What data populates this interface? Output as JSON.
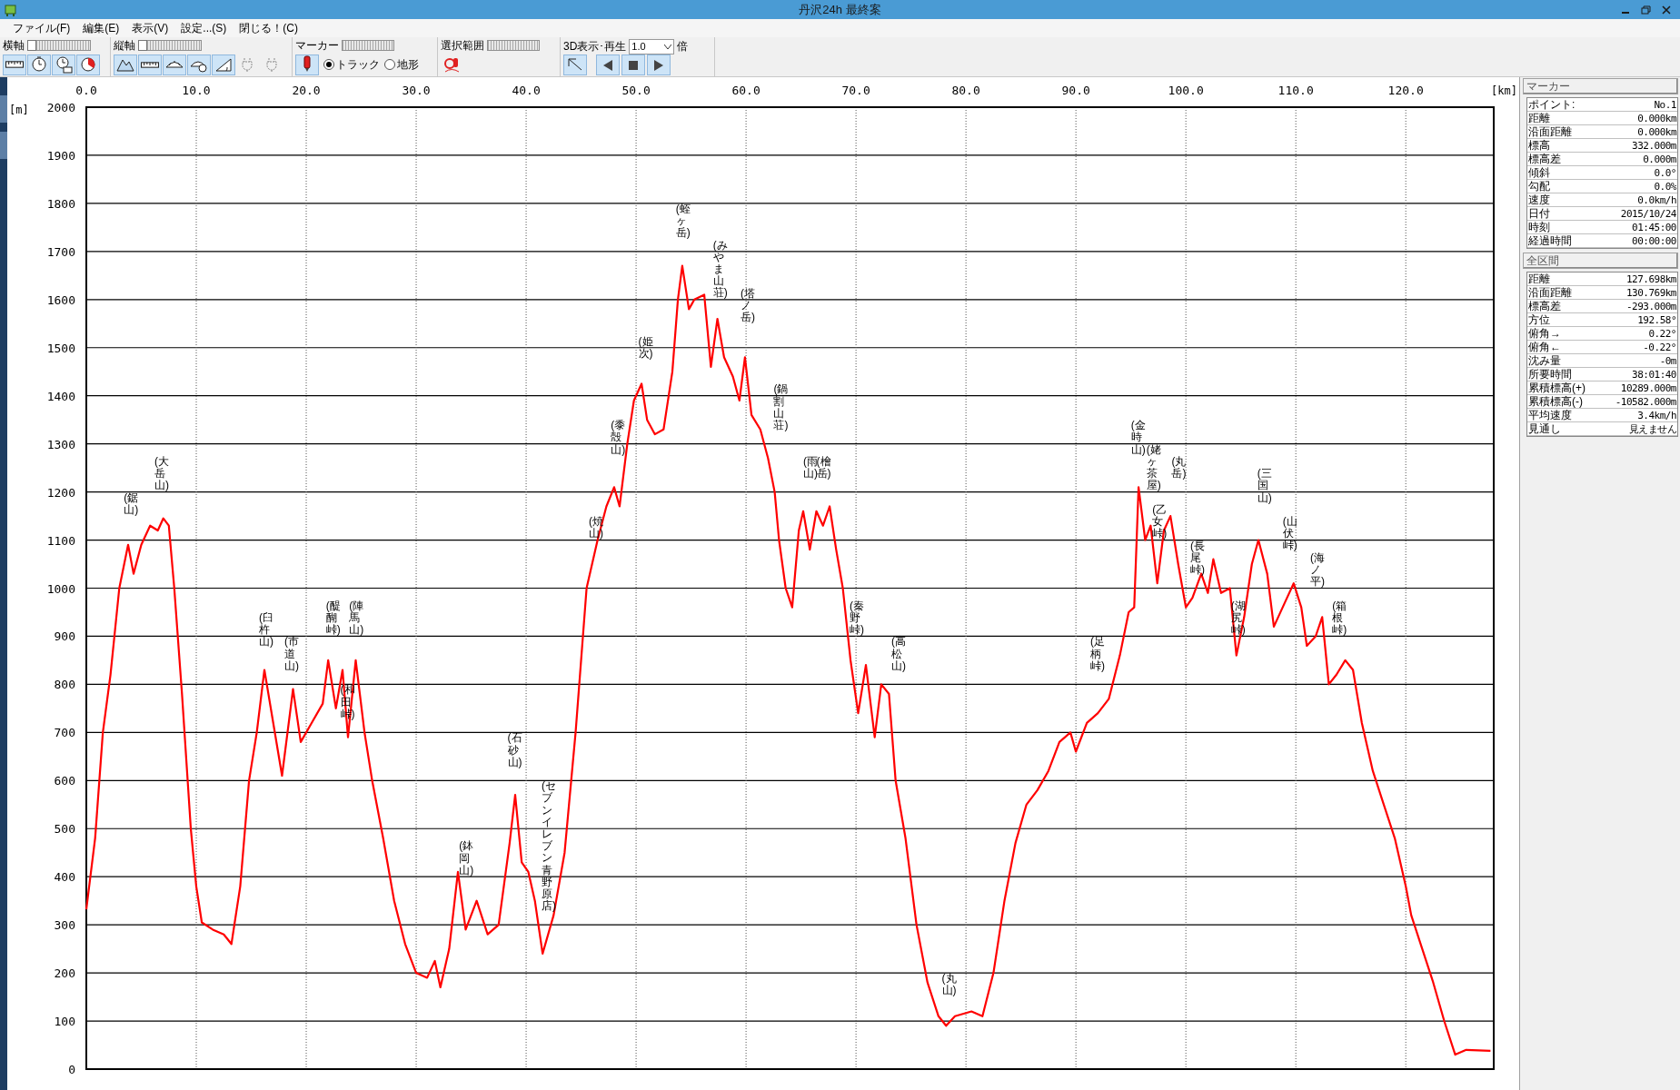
{
  "window": {
    "title": "丹沢24h 最終案"
  },
  "menu": [
    "ファイル(F)",
    "編集(E)",
    "表示(V)",
    "設定...(S)",
    "閉じる！(C)"
  ],
  "toolbar": {
    "horizontal_axis": {
      "label": "横軸",
      "level": 0
    },
    "vertical_axis": {
      "label": "縦軸",
      "level": 0
    },
    "marker": {
      "label": "マーカー",
      "options": [
        {
          "label": "トラック",
          "selected": true
        },
        {
          "label": "地形",
          "selected": false
        }
      ]
    },
    "selection": {
      "label": "選択範囲"
    },
    "playback": {
      "label": "3D表示･再生",
      "speed": "1.0",
      "unit": "倍"
    }
  },
  "chart": {
    "chart_data": {
      "type": "line",
      "grid": true,
      "xlabel": "[km]",
      "ylabel": "[m]",
      "xlim": [
        0,
        128
      ],
      "ylim": [
        0,
        2000
      ],
      "xticks": [
        {
          "value": 0,
          "label": "0.0"
        },
        {
          "value": 10,
          "label": "10.0"
        },
        {
          "value": 20,
          "label": "20.0"
        },
        {
          "value": 30,
          "label": "30.0"
        },
        {
          "value": 40,
          "label": "40.0"
        },
        {
          "value": 50,
          "label": "50.0"
        },
        {
          "value": 60,
          "label": "60.0"
        },
        {
          "value": 70,
          "label": "70.0"
        },
        {
          "value": 80,
          "label": "80.0"
        },
        {
          "value": 90,
          "label": "90.0"
        },
        {
          "value": 100,
          "label": "100.0"
        },
        {
          "value": 110,
          "label": "110.0"
        },
        {
          "value": 120,
          "label": "120.0"
        }
      ],
      "yticks": [
        0,
        100,
        200,
        300,
        400,
        500,
        600,
        700,
        800,
        900,
        1000,
        1100,
        1200,
        1300,
        1400,
        1500,
        1600,
        1700,
        1800,
        1900,
        2000
      ],
      "x": [
        0,
        0.8,
        1.5,
        2.2,
        3.0,
        3.8,
        4.3,
        5.0,
        5.8,
        6.5,
        7.0,
        7.5,
        8.0,
        8.7,
        9.5,
        10.0,
        10.5,
        11.5,
        12.5,
        13.2,
        14.0,
        14.8,
        15.5,
        16.2,
        17.0,
        17.8,
        18.8,
        19.5,
        20.5,
        21.5,
        22.0,
        22.7,
        23.3,
        23.8,
        24.5,
        25.3,
        26.0,
        27.0,
        28.0,
        29.0,
        30.0,
        31.0,
        31.7,
        32.2,
        33.0,
        33.8,
        34.5,
        35.5,
        36.5,
        37.5,
        38.5,
        39.0,
        39.6,
        40.2,
        40.8,
        41.5,
        42.5,
        43.5,
        44.5,
        45.5,
        46.5,
        47.3,
        48.0,
        48.5,
        49.2,
        49.8,
        50.5,
        51.0,
        51.7,
        52.5,
        53.3,
        53.8,
        54.2,
        54.8,
        55.3,
        56.2,
        56.8,
        57.4,
        58.0,
        58.8,
        59.4,
        59.9,
        60.5,
        61.3,
        62.0,
        62.6,
        63.0,
        63.6,
        64.2,
        64.8,
        65.2,
        65.8,
        66.4,
        67.0,
        67.6,
        68.2,
        68.8,
        69.5,
        70.2,
        70.9,
        71.7,
        72.3,
        73.0,
        73.6,
        74.5,
        75.5,
        76.5,
        77.5,
        78.2,
        79.0,
        80.5,
        81.5,
        82.5,
        83.5,
        84.5,
        85.5,
        86.5,
        87.5,
        88.5,
        89.5,
        90.0,
        91.0,
        92.0,
        93.0,
        94.0,
        94.8,
        95.3,
        95.7,
        96.3,
        96.8,
        97.4,
        98.0,
        98.6,
        99.3,
        100.0,
        100.6,
        101.4,
        102.0,
        102.5,
        103.2,
        104.0,
        104.6,
        105.3,
        106.0,
        106.6,
        107.4,
        108.0,
        109.0,
        109.8,
        110.5,
        111.0,
        111.8,
        112.4,
        113.0,
        113.7,
        114.5,
        115.2,
        116.0,
        117.0,
        118.0,
        119.0,
        120.0,
        120.5,
        121.5,
        122.5,
        123.5,
        124.5,
        125.5,
        127.7
      ],
      "series": [
        {
          "color": "#ff0000",
          "values": [
            332,
            480,
            700,
            820,
            1000,
            1090,
            1030,
            1090,
            1130,
            1120,
            1145,
            1130,
            1000,
            780,
            500,
            380,
            305,
            290,
            280,
            260,
            380,
            600,
            700,
            830,
            720,
            610,
            790,
            680,
            720,
            760,
            850,
            750,
            830,
            690,
            850,
            700,
            600,
            480,
            350,
            260,
            200,
            190,
            225,
            170,
            250,
            410,
            290,
            350,
            280,
            300,
            470,
            570,
            430,
            410,
            350,
            240,
            320,
            450,
            700,
            1000,
            1100,
            1170,
            1210,
            1170,
            1300,
            1390,
            1425,
            1350,
            1320,
            1330,
            1450,
            1600,
            1670,
            1580,
            1600,
            1610,
            1460,
            1560,
            1480,
            1440,
            1390,
            1480,
            1360,
            1330,
            1270,
            1200,
            1100,
            1000,
            960,
            1120,
            1160,
            1080,
            1160,
            1130,
            1170,
            1080,
            1000,
            850,
            740,
            840,
            690,
            800,
            780,
            600,
            480,
            300,
            180,
            110,
            90,
            110,
            120,
            110,
            200,
            350,
            470,
            550,
            580,
            620,
            680,
            700,
            660,
            720,
            740,
            770,
            860,
            950,
            960,
            1210,
            1100,
            1130,
            1010,
            1120,
            1150,
            1050,
            960,
            980,
            1030,
            990,
            1060,
            990,
            1000,
            860,
            940,
            1050,
            1100,
            1030,
            920,
            970,
            1010,
            960,
            880,
            900,
            940,
            800,
            820,
            850,
            830,
            720,
            620,
            550,
            480,
            380,
            320,
            250,
            180,
            100,
            30,
            40,
            38
          ]
        }
      ],
      "annotations": [
        "(鋸山)",
        "(大岳山)",
        "(臼杵山)",
        "(市道山)",
        "(醍醐峠)",
        "(和田峠)",
        "(陣馬山)",
        "(鉢岡山)",
        "(石砂山)",
        "(セブンイレブン青野原店)",
        "(焼山)",
        "(黍殻山)",
        "(姫次)",
        "(蛭ヶ岳)",
        "(みやま山荘)",
        "(塔ノ岳)",
        "(鍋割山荘)",
        "(雨山)",
        "(檜岳)",
        "(秦野峠)",
        "(高松山)",
        "(丸山)",
        "(足柄峠)",
        "(金時山)",
        "(姥ヶ茶屋)",
        "(乙女峠)",
        "(丸岳)",
        "(長尾峠)",
        "(湖尻峠)",
        "(三国山)",
        "(山伏峠)",
        "(海ノ平)",
        "(箱根峠)"
      ]
    }
  },
  "marker_panel": {
    "title": "マーカー",
    "rows": [
      {
        "label": "ポイント:",
        "value": "No.1"
      },
      {
        "label": "距離",
        "value": "0.000km"
      },
      {
        "label": "沿面距離",
        "value": "0.000km"
      },
      {
        "label": "標高",
        "value": "332.000m"
      },
      {
        "label": "標高差",
        "value": "0.000m"
      },
      {
        "label": "傾斜",
        "value": "0.0°"
      },
      {
        "label": "勾配",
        "value": "0.0%"
      },
      {
        "label": "速度",
        "value": "0.0km/h"
      },
      {
        "label": "日付",
        "value": "2015/10/24"
      },
      {
        "label": "時刻",
        "value": "01:45:00"
      },
      {
        "label": "経過時間",
        "value": "00:00:00"
      }
    ]
  },
  "total_panel": {
    "title": "全区間",
    "rows": [
      {
        "label": "距離",
        "value": "127.698km"
      },
      {
        "label": "沿面距離",
        "value": "130.769km"
      },
      {
        "label": "標高差",
        "value": "-293.000m"
      },
      {
        "label": "方位",
        "value": "192.58°"
      },
      {
        "label": "俯角→",
        "value": "0.22°"
      },
      {
        "label": "俯角←",
        "value": "-0.22°"
      },
      {
        "label": "沈み量",
        "value": "-0m"
      },
      {
        "label": "所要時間",
        "value": "38:01:40"
      },
      {
        "label": "累積標高(+)",
        "value": "10289.000m"
      },
      {
        "label": "累積標高(-)",
        "value": "-10582.000m"
      },
      {
        "label": "平均速度",
        "value": "3.4km/h"
      },
      {
        "label": "見通し",
        "value": "見えません"
      }
    ]
  }
}
